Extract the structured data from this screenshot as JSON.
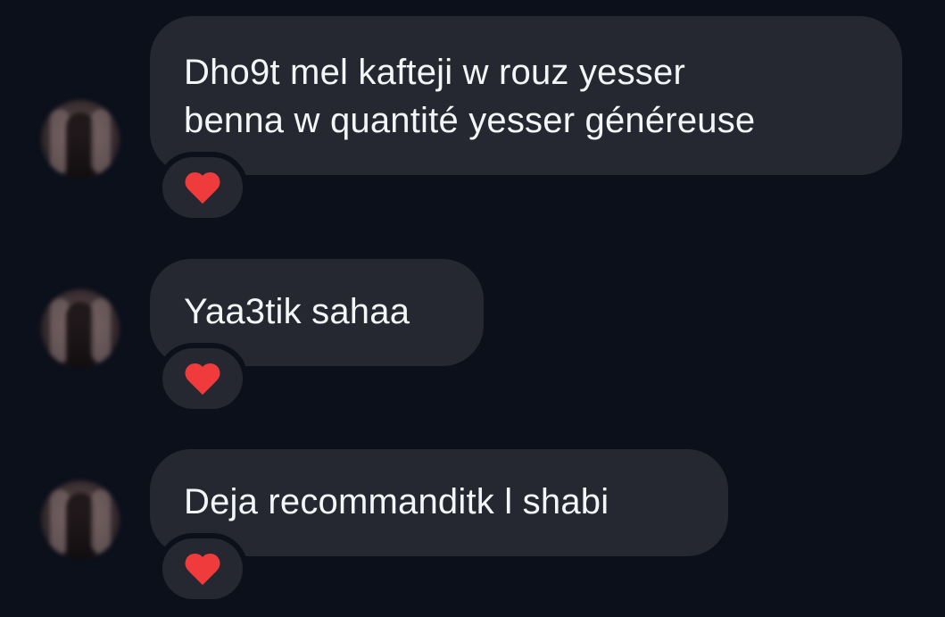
{
  "messages": [
    {
      "lines": [
        "Dho9t mel kafteji w rouz yesser",
        "benna w quantité yesser généreuse"
      ],
      "reaction": "red-heart"
    },
    {
      "lines": [
        "Yaa3tik sahaa"
      ],
      "reaction": "red-heart"
    },
    {
      "lines": [
        "Deja recommanditk l shabi"
      ],
      "reaction": "red-heart"
    }
  ],
  "colors": {
    "background": "#0c101b",
    "bubble": "#252830",
    "text": "#f4f5f7",
    "heart": "#ef3b3b"
  }
}
